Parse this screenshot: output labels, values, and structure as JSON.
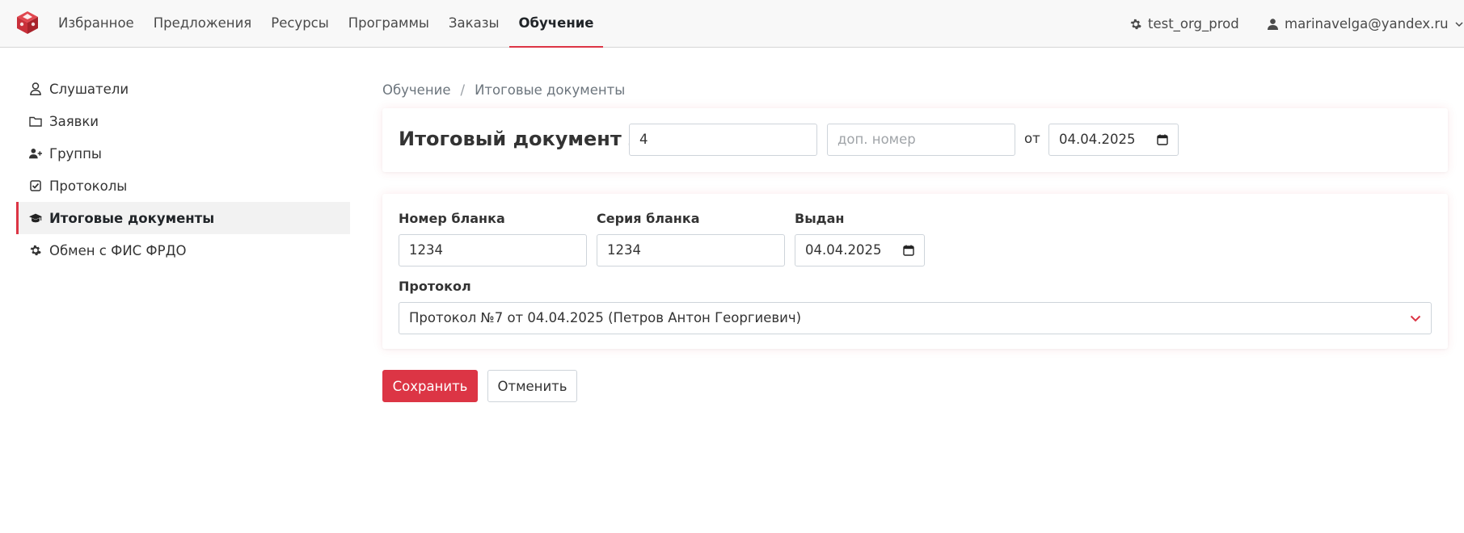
{
  "nav": {
    "items": [
      {
        "label": "Избранное"
      },
      {
        "label": "Предложения"
      },
      {
        "label": "Ресурсы"
      },
      {
        "label": "Программы"
      },
      {
        "label": "Заказы"
      },
      {
        "label": "Обучение",
        "active": true
      }
    ],
    "org": "test_org_prod",
    "user": "marinavelga@yandex.ru"
  },
  "sidebar": {
    "items": [
      {
        "label": "Слушатели",
        "icon": "user-icon"
      },
      {
        "label": "Заявки",
        "icon": "folder-icon"
      },
      {
        "label": "Группы",
        "icon": "user-plus-icon"
      },
      {
        "label": "Протоколы",
        "icon": "check-square-icon"
      },
      {
        "label": "Итоговые документы",
        "icon": "graduation-cap-icon",
        "active": true
      },
      {
        "label": "Обмен с ФИС ФРДО",
        "icon": "gear-icon"
      }
    ]
  },
  "breadcrumb": {
    "parent": "Обучение",
    "separator": "/",
    "current": "Итоговые документы"
  },
  "document": {
    "title": "Итоговый документ №",
    "number_value": "4",
    "extra_number_placeholder": "доп. номер",
    "from_label": "от",
    "date_value": "04.04.2025"
  },
  "form": {
    "blank_number_label": "Номер бланка",
    "blank_number_value": "1234",
    "blank_series_label": "Серия бланка",
    "blank_series_value": "1234",
    "issued_label": "Выдан",
    "issued_value": "04.04.2025",
    "protocol_label": "Протокол",
    "protocol_value": "Протокол №7 от 04.04.2025 (Петров Антон Георгиевич)"
  },
  "actions": {
    "save_label": "Сохранить",
    "cancel_label": "Отменить"
  },
  "colors": {
    "accent": "#dc3545",
    "navbar_bg": "#f8f8f8"
  }
}
